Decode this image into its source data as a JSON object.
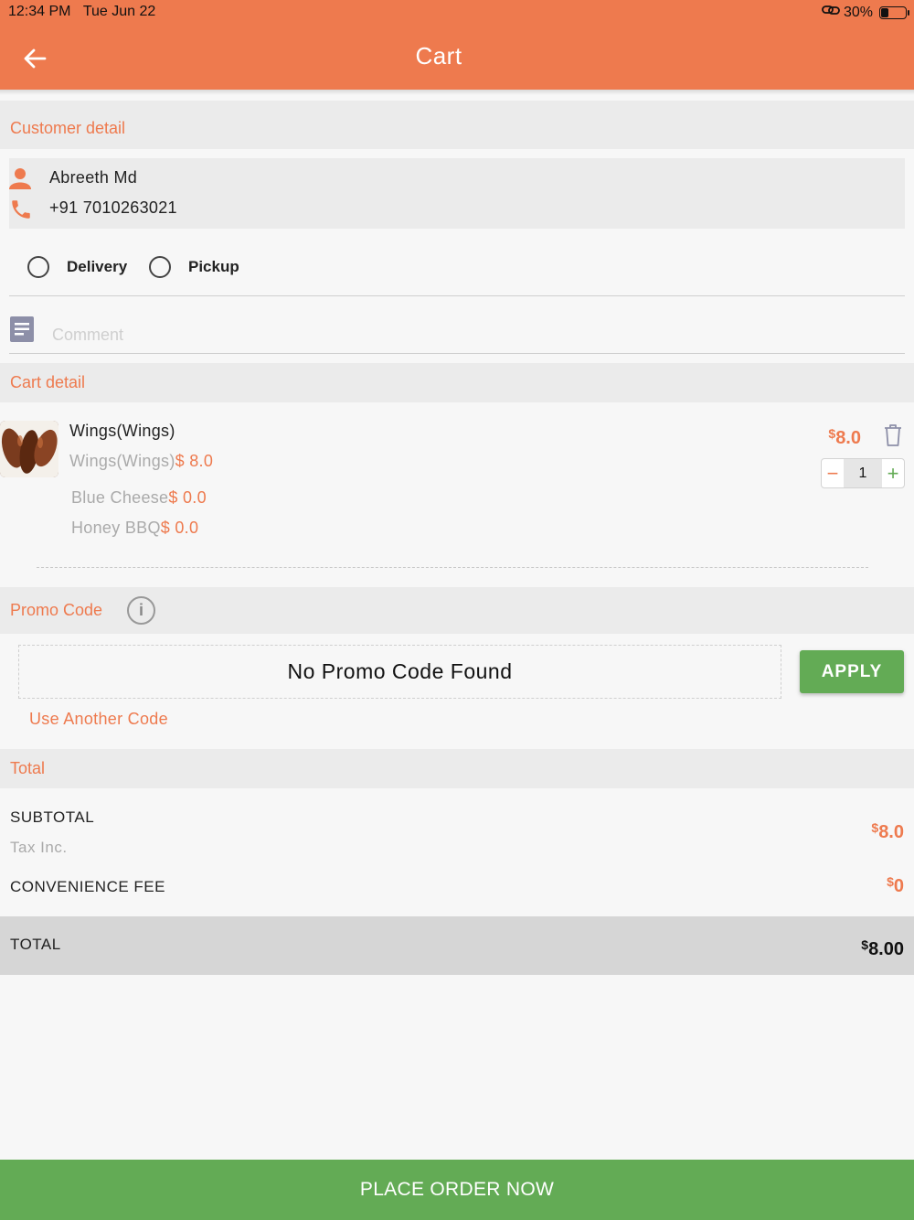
{
  "status_bar": {
    "time": "12:34 PM",
    "date": "Tue Jun 22",
    "battery": "30%",
    "battery_level": 0.3
  },
  "header": {
    "title": "Cart",
    "back_icon": "arrow-left-icon"
  },
  "customer_section": {
    "title": "Customer detail",
    "name": "Abreeth Md",
    "phone": "+91 7010263021"
  },
  "order_type": {
    "options": [
      {
        "label": "Delivery",
        "selected": false
      },
      {
        "label": "Pickup",
        "selected": false
      }
    ]
  },
  "comment": {
    "placeholder": "Comment",
    "value": ""
  },
  "cart_section": {
    "title": "Cart detail",
    "item": {
      "name": "Wings(Wings)",
      "variant": "Wings(Wings)",
      "variant_price": "$ 8.0",
      "addons": [
        {
          "name": "Blue Cheese",
          "price": "$ 0.0"
        },
        {
          "name": "Honey BBQ",
          "price": "$ 0.0"
        }
      ],
      "price_symbol": "$",
      "price": "8.0",
      "quantity": "1",
      "decrement": "−",
      "increment": "+"
    }
  },
  "promo_section": {
    "title": "Promo Code",
    "info_glyph": "i",
    "empty_text": "No Promo Code Found",
    "apply_label": "APPLY",
    "use_another_label": "Use Another Code"
  },
  "totals_section": {
    "title": "Total",
    "subtotal_label": "SUBTOTAL",
    "tax_note": "Tax Inc.",
    "subtotal_symbol": "$",
    "subtotal_value": "8.0",
    "fee_label": "CONVENIENCE FEE",
    "fee_symbol": "$",
    "fee_value": "0",
    "total_label": "TOTAL",
    "total_symbol": "$",
    "total_value": "8.00"
  },
  "place_order_label": "PLACE ORDER NOW",
  "colors": {
    "accent": "#ee7a4e",
    "primary_button": "#63ab55",
    "section_bg": "#ebebeb"
  }
}
